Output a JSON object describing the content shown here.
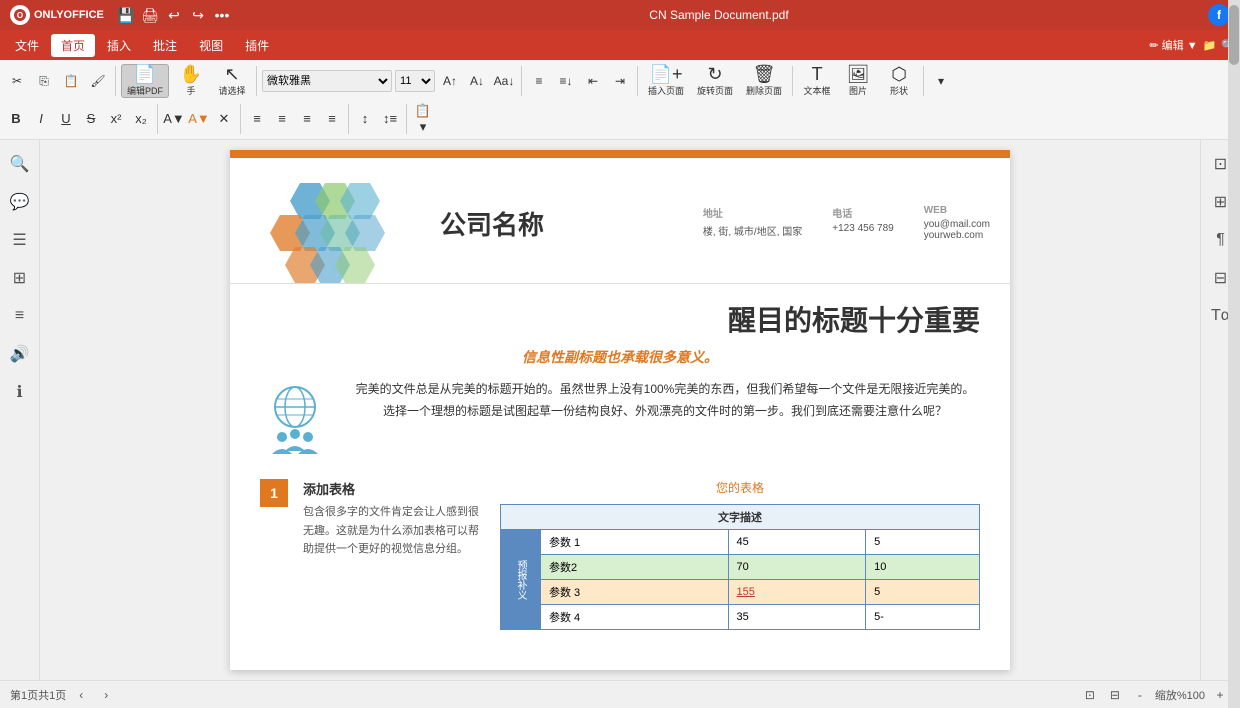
{
  "titlebar": {
    "app_name": "ONLYOFFICE",
    "doc_name": "CN Sample Document.pdf",
    "save_icon": "💾",
    "print_icon": "🖨",
    "undo_icon": "↩",
    "redo_icon": "↪",
    "more_icon": "•••",
    "user_icon": "f"
  },
  "menubar": {
    "items": [
      "文件",
      "首页",
      "插入",
      "批注",
      "视图",
      "插件"
    ],
    "active": "首页"
  },
  "toolbar": {
    "row1": {
      "cut_label": "剪切",
      "copy_label": "复制",
      "paste_label": "粘贴",
      "format_label": "格式刷",
      "edit_pdf_label": "编辑PDF",
      "hand_label": "手",
      "select_label": "请选择",
      "font_name": "微软雅黑",
      "font_size": "11",
      "inc_size": "A↑",
      "dec_size": "A↓",
      "case_btn": "Aa↓",
      "list_btns": [
        "≡↑",
        "≡↓",
        "≡←",
        "≡→"
      ],
      "insert_page_label": "插入页面",
      "rotate_label": "旋转页面",
      "delete_label": "删除页面",
      "textbox_label": "文本框",
      "image_label": "图片",
      "shape_label": "形状"
    },
    "row2": {
      "bold": "B",
      "italic": "I",
      "underline": "U",
      "strike": "S",
      "superscript": "x²",
      "subscript": "x₂",
      "highlight": "A▼",
      "color": "A▼",
      "clear": "✕",
      "align_btns": [
        "≡←",
        "≡↓",
        "≡↑",
        "≡→"
      ]
    }
  },
  "left_sidebar": {
    "icons": [
      "🔍",
      "💬",
      "📋",
      "☰",
      "📄",
      "🔊",
      "ℹ"
    ]
  },
  "right_sidebar": {
    "icons": [
      "⊡",
      "⊞",
      "¶",
      "⊟",
      "Tα"
    ]
  },
  "document": {
    "company_header": {
      "company_name": "公司名称",
      "address_label": "地址",
      "address_value": "楼, 街, 城市/地区, 国家",
      "phone_label": "电话",
      "phone_value": "+123 456 789",
      "web_label": "WEB",
      "web_value1": "you@mail.com",
      "web_value2": "yourweb.com"
    },
    "main_title": "醒目的标题十分重要",
    "sub_title": "信息性副标题也承载很多意义。",
    "body_text": "完美的文件总是从完美的标题开始的。虽然世界上没有100%完美的东西，但我们希望每一个文件是无限接近完美的。选择一个理想的标题是试图起草一份结构良好、外观漂亮的文件时的第一步。我们到底还需要注意什么呢？",
    "section1": {
      "number": "1",
      "title": "添加表格",
      "body": "包含很多字的文件肯定会让人感到很无趣。这就是为什么添加表格可以帮助提供一个更好的视觉信息分组。"
    },
    "table": {
      "title": "您的表格",
      "header": "文字描述",
      "row_label": "预报补义",
      "rows": [
        {
          "label": "参数 1",
          "val1": "45",
          "val2": "5",
          "style": ""
        },
        {
          "label": "参数2",
          "val1": "70",
          "val2": "10",
          "style": "green"
        },
        {
          "label": "参数 3",
          "val1": "155",
          "val2": "5",
          "style": "orange",
          "val1_link": true
        },
        {
          "label": "参数 4",
          "val1": "35",
          "val2": "5-",
          "style": ""
        }
      ]
    }
  },
  "statusbar": {
    "page_info": "第1页共1页",
    "zoom_label": "缩放%100",
    "zoom_out": "-",
    "zoom_in": "+"
  }
}
